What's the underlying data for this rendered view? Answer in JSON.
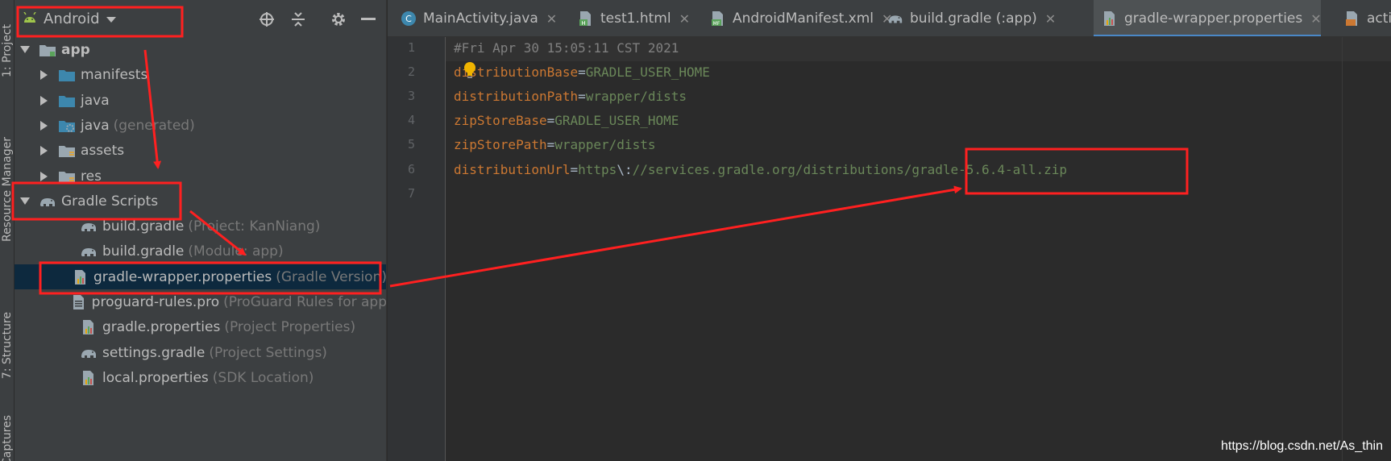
{
  "side_strip": {
    "tabs": [
      {
        "label": "1: Project"
      },
      {
        "label": "Resource Manager"
      },
      {
        "label": "7: Structure"
      },
      {
        "label": "Captures"
      }
    ]
  },
  "project_panel": {
    "view_selector": {
      "label": "Android",
      "icon": "android-icon"
    },
    "toolbar_icons": [
      "locate-icon",
      "collapse-all-icon",
      "gear-icon",
      "hide-icon"
    ],
    "tree": [
      {
        "name": "app",
        "hint": "",
        "icon": "module-folder-icon",
        "expanded": true
      },
      {
        "name": "manifests",
        "hint": "",
        "icon": "folder-icon"
      },
      {
        "name": "java",
        "hint": "",
        "icon": "folder-icon"
      },
      {
        "name": "java",
        "hint": "(generated)",
        "icon": "generated-folder-icon"
      },
      {
        "name": "assets",
        "hint": "",
        "icon": "assets-folder-icon"
      },
      {
        "name": "res",
        "hint": "",
        "icon": "res-folder-icon"
      },
      {
        "name": "Gradle Scripts",
        "hint": "",
        "icon": "gradle-elephant-icon",
        "expanded": true
      },
      {
        "name": "build.gradle",
        "hint": "(Project: KanNiang)",
        "icon": "gradle-elephant-icon"
      },
      {
        "name": "build.gradle",
        "hint": "(Module: app)",
        "icon": "gradle-elephant-icon"
      },
      {
        "name": "gradle-wrapper.properties",
        "hint": "(Gradle Version)",
        "icon": "properties-file-icon",
        "selected": true
      },
      {
        "name": "proguard-rules.pro",
        "hint": "(ProGuard Rules for app",
        "icon": "text-file-icon"
      },
      {
        "name": "gradle.properties",
        "hint": "(Project Properties)",
        "icon": "properties-file-icon"
      },
      {
        "name": "settings.gradle",
        "hint": "(Project Settings)",
        "icon": "gradle-elephant-icon"
      },
      {
        "name": "local.properties",
        "hint": "(SDK Location)",
        "icon": "properties-file-icon"
      }
    ]
  },
  "editor": {
    "tabs": [
      {
        "label": "MainActivity.java",
        "icon": "java-class-icon",
        "close": "✕"
      },
      {
        "label": "test1.html",
        "icon": "html-file-icon",
        "close": "✕"
      },
      {
        "label": "AndroidManifest.xml",
        "icon": "manifest-file-icon",
        "close": "✕"
      },
      {
        "label": "build.gradle (:app)",
        "icon": "gradle-elephant-icon",
        "close": "✕"
      },
      {
        "label": "gradle-wrapper.properties",
        "icon": "properties-file-icon",
        "close": "✕",
        "active": true
      },
      {
        "label": "acti",
        "icon": "layout-file-icon",
        "close": ""
      }
    ],
    "line_numbers": [
      "1",
      "2",
      "3",
      "4",
      "5",
      "6",
      "7"
    ],
    "lines": [
      {
        "comment": "#Fri Apr 30 15:05:11 CST 2021"
      },
      {
        "key": "distributionBase",
        "eq": "=",
        "value": "GRADLE_USER_HOME"
      },
      {
        "key": "distributionPath",
        "eq": "=",
        "value": "wrapper/dists"
      },
      {
        "key": "zipStoreBase",
        "eq": "=",
        "value": "GRADLE_USER_HOME"
      },
      {
        "key": "zipStorePath",
        "eq": "=",
        "value": "wrapper/dists"
      },
      {
        "key": "distributionUrl",
        "eq": "=",
        "value": "https",
        "escape": "\\:",
        "value2": "//services.gradle.org/distributions/gradle-5.6.4-all.zip"
      },
      {
        "comment": ""
      }
    ]
  },
  "watermark": "https://blog.csdn.net/As_thin",
  "colors": {
    "annotation": "#ff2020",
    "selection": "#0d293e",
    "key": "#cc7832",
    "value": "#6a8759",
    "comment": "#808080"
  }
}
